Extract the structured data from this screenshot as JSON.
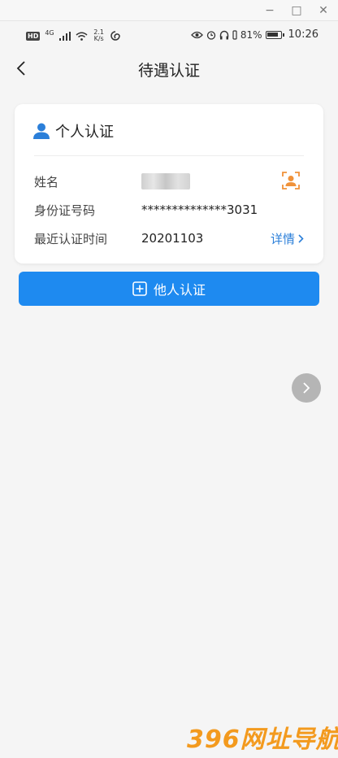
{
  "window": {
    "minimize": "−",
    "maximize": "□",
    "close": "✕"
  },
  "statusbar": {
    "hd": "HD",
    "network": "4G",
    "speed_value": "2.1",
    "speed_unit": "K/s",
    "battery_percent": "81%",
    "time": "10:26"
  },
  "navbar": {
    "title": "待遇认证"
  },
  "card": {
    "title": "个人认证",
    "rows": [
      {
        "label": "姓名",
        "value": ""
      },
      {
        "label": "身份证号码",
        "value": "**************3031"
      },
      {
        "label": "最近认证时间",
        "value": "20201103"
      }
    ],
    "detail_label": "详情",
    "accent_color": "#2b7fd9",
    "face_icon_color": "#f0923a"
  },
  "primary_button": {
    "label": "他人认证",
    "color": "#1e8af0"
  },
  "watermark": {
    "text": "396网址导航"
  }
}
